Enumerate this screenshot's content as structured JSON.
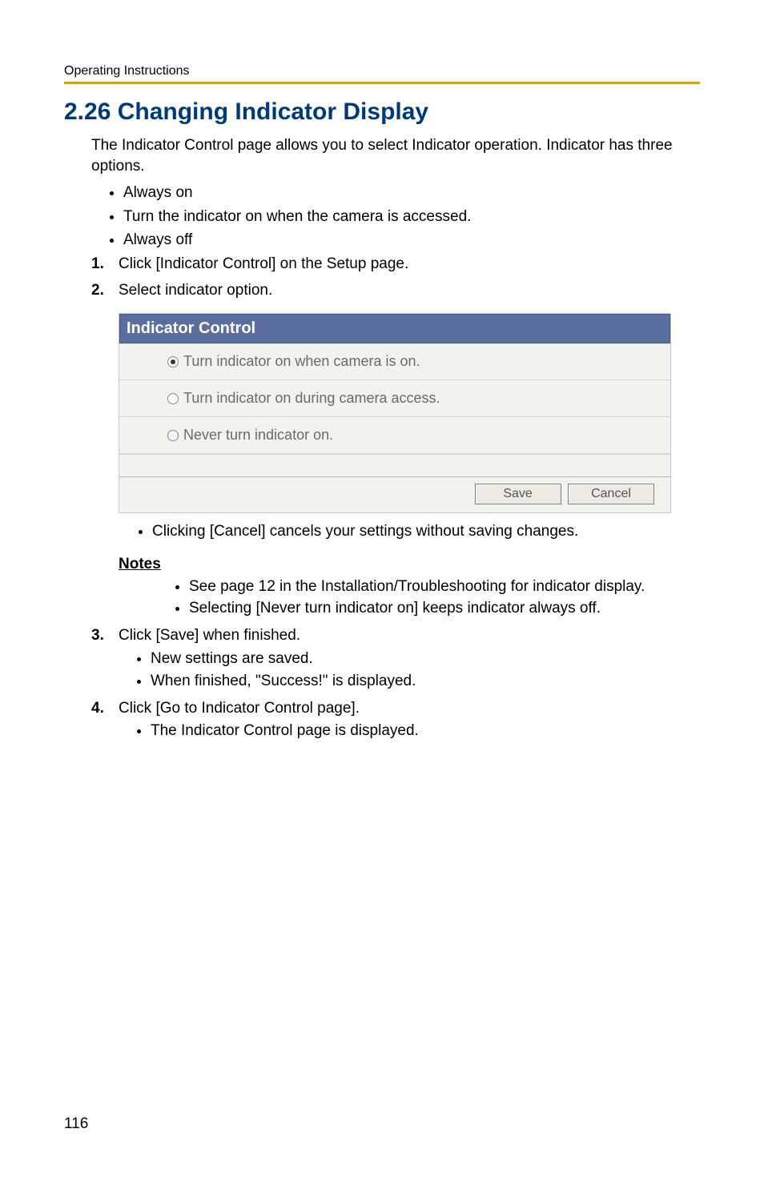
{
  "header": {
    "label": "Operating Instructions"
  },
  "heading": "2.26  Changing Indicator Display",
  "intro": "The Indicator Control page allows you to select Indicator operation. Indicator has three options.",
  "bullets": [
    "Always on",
    "Turn the indicator on when the camera is accessed.",
    "Always off"
  ],
  "steps": {
    "s1": {
      "num": "1.",
      "text": "Click [Indicator Control] on the Setup page."
    },
    "s2": {
      "num": "2.",
      "text": "Select indicator option."
    },
    "s3": {
      "num": "3.",
      "text": "Click [Save] when finished."
    },
    "s4": {
      "num": "4.",
      "text": "Click [Go to Indicator Control page]."
    }
  },
  "screenshot": {
    "title": "Indicator Control",
    "options": [
      "Turn indicator on when camera is on.",
      "Turn indicator on during camera access.",
      "Never turn indicator on."
    ],
    "save": "Save",
    "cancel": "Cancel"
  },
  "after_screenshot_bullet": "Clicking [Cancel] cancels your settings without saving changes.",
  "notes": {
    "heading": "Notes",
    "items": [
      "See page 12 in the Installation/Troubleshooting for indicator display.",
      "Selecting [Never turn indicator on] keeps indicator always off."
    ]
  },
  "step3_sub": [
    "New settings are saved.",
    "When finished, \"Success!\" is displayed."
  ],
  "step4_sub": [
    "The Indicator Control page is displayed."
  ],
  "page_number": "116"
}
